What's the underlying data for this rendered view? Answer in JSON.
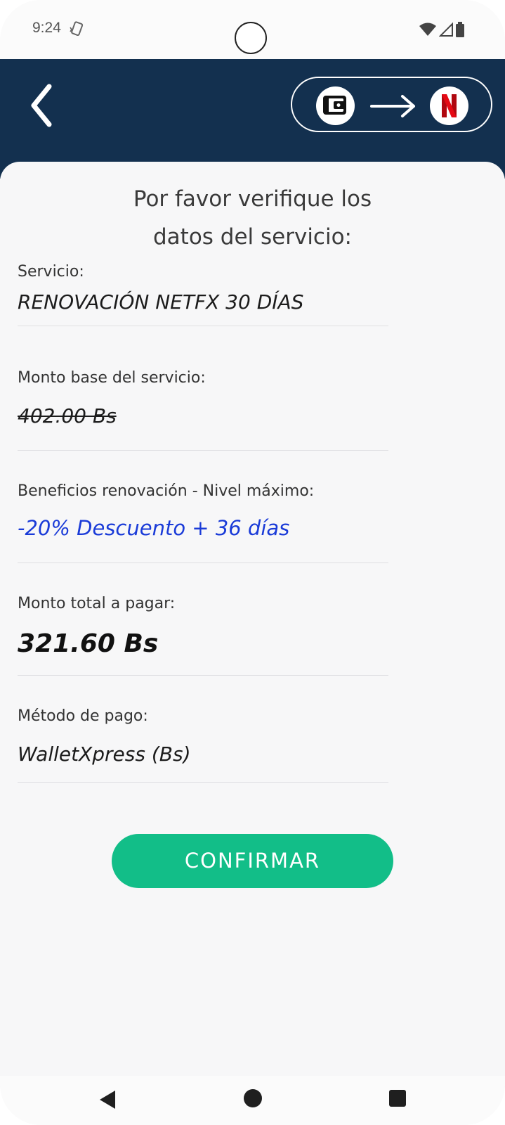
{
  "status_bar": {
    "time": "9:24"
  },
  "header": {
    "back_icon": "chevron-left-icon",
    "from_icon": "wallet-icon",
    "arrow_icon": "arrow-right-icon",
    "to_icon": "netflix-icon"
  },
  "page": {
    "title_line1": "Por favor verifique los",
    "title_line2": "datos del servicio:"
  },
  "fields": {
    "service": {
      "label": "Servicio:",
      "value": "RENOVACIÓN NETFX 30 DÍAS"
    },
    "base_amount": {
      "label": "Monto base del servicio:",
      "value": "402.00 Bs"
    },
    "benefits": {
      "label": "Beneficios renovación - Nivel máximo:",
      "value": "-20% Descuento + 36 días"
    },
    "total": {
      "label": "Monto total a pagar:",
      "value": "321.60 Bs"
    },
    "payment_method": {
      "label": "Método de pago:",
      "value": "WalletXpress (Bs)"
    }
  },
  "actions": {
    "confirm_label": "CONFIRMAR"
  },
  "colors": {
    "header_bg": "#13304f",
    "confirm_bg": "#12be88",
    "benefit_text": "#1a3bd8",
    "netflix_red": "#e50914"
  }
}
